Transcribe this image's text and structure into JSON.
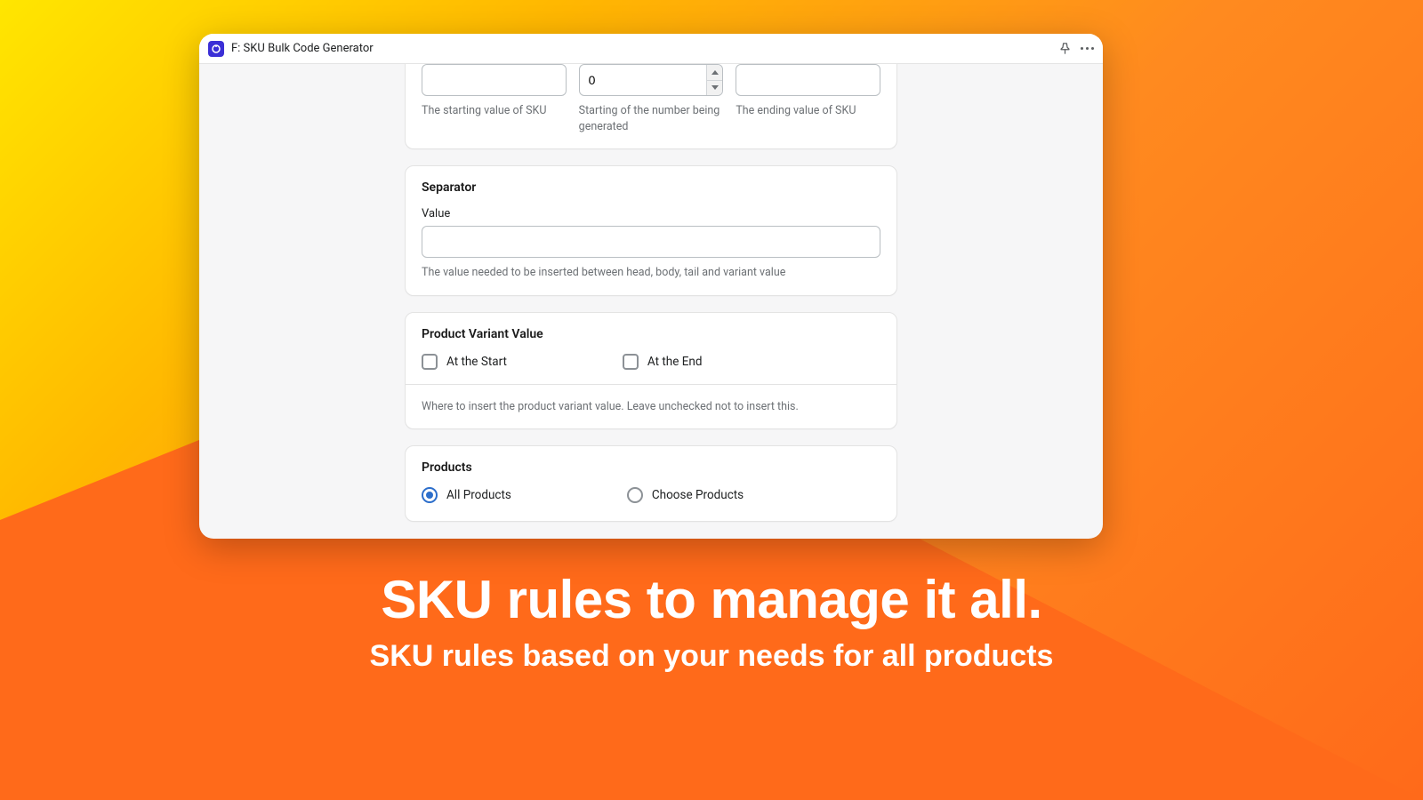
{
  "window": {
    "title": "F: SKU Bulk Code Generator"
  },
  "top_fields": {
    "head_help": "The starting value of SKU",
    "number_value": "0",
    "number_help": "Starting of the number being generated",
    "tail_help": "The ending value of SKU"
  },
  "separator": {
    "title": "Separator",
    "label": "Value",
    "help": "The value needed to be inserted between head, body, tail and variant value"
  },
  "variant": {
    "title": "Product Variant Value",
    "opt_start": "At the Start",
    "opt_end": "At the End",
    "help": "Where to insert the product variant value. Leave unchecked not to insert this."
  },
  "products": {
    "title": "Products",
    "opt_all": "All Products",
    "opt_choose": "Choose Products"
  },
  "hero": {
    "title": "SKU rules to manage it all.",
    "subtitle": "SKU rules based on your needs for all products"
  }
}
